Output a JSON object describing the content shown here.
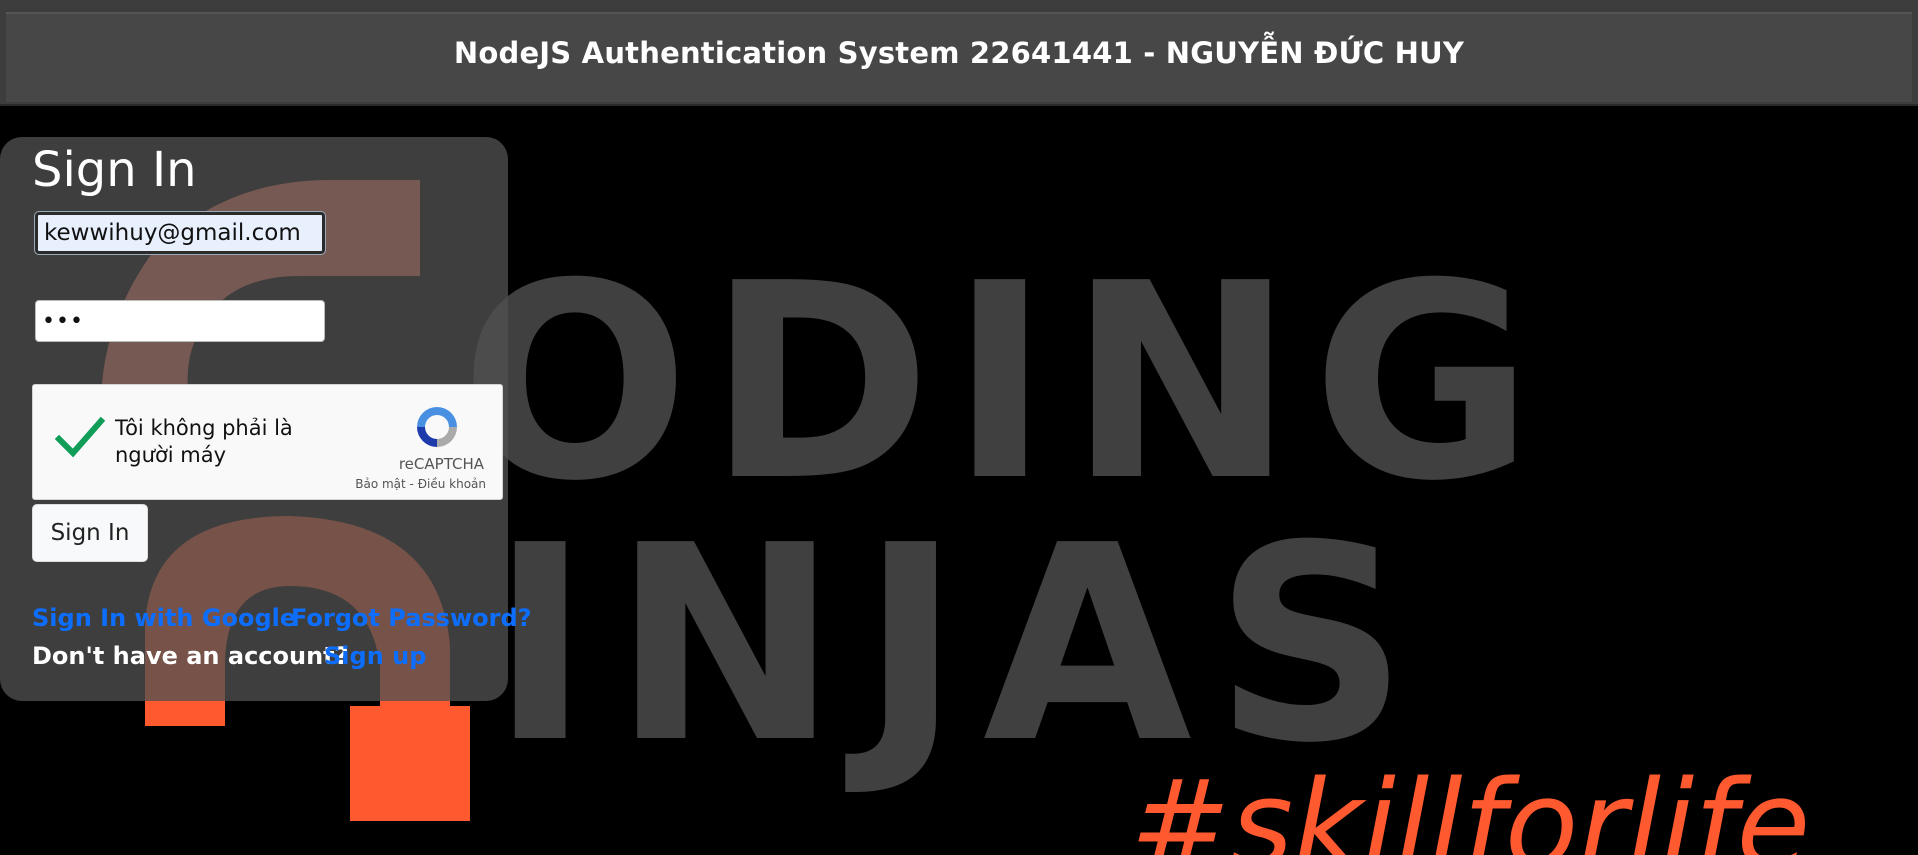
{
  "header": {
    "title": "NodeJS Authentication System 22641441 - NGUYỄN ĐỨC HUY"
  },
  "background": {
    "logo_text": "#skillforlife",
    "brand_color": "#ff5a2f",
    "text_color": "#404040"
  },
  "signin_form": {
    "title": "Sign In",
    "email_value": "kewwihuy@gmail.com",
    "password_value": "•••",
    "recaptcha": {
      "label": "Tôi không phải là người máy",
      "brand": "reCAPTCHA",
      "terms": "Bảo mật - Điều khoản",
      "checked": true
    },
    "submit_label": "Sign In",
    "google_link": "Sign In with Google",
    "forgot_link": "Forgot Password?",
    "no_account_text": "Don't have an account?",
    "signup_link": "Sign up"
  },
  "colors": {
    "link": "#0d6efd",
    "header_bg": "#474747",
    "card_bg": "#505050"
  }
}
